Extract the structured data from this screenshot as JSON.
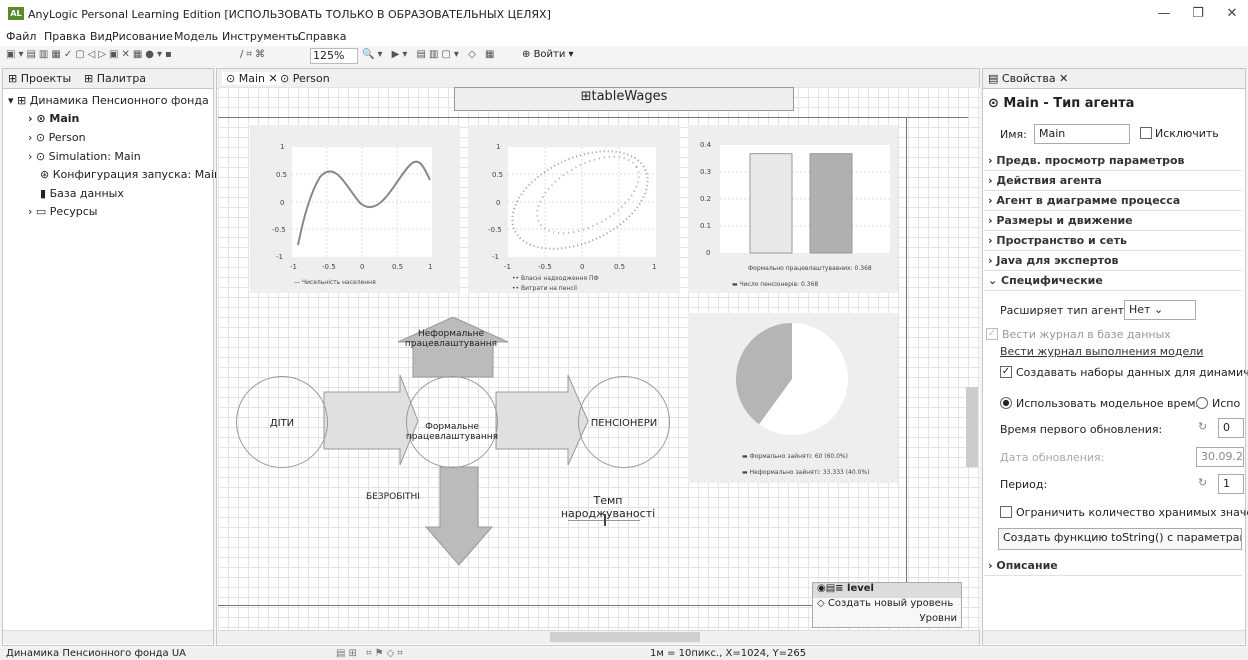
{
  "window": {
    "title": "AnyLogic Personal Learning Edition [ИСПОЛЬЗОВАТЬ ТОЛЬКО В ОБРАЗОВАТЕЛЬНЫХ ЦЕЛЯХ]",
    "app_icon_text": "AL"
  },
  "menu": [
    "Файл",
    "Правка",
    "Вид",
    "Рисование",
    "Модель",
    "Инструменты",
    "Справка"
  ],
  "toolbar": {
    "zoom": "125%",
    "login": "Войти"
  },
  "left_panel": {
    "tab_projects": "Проекты",
    "tab_palette": "Палитра",
    "tree": [
      {
        "label": "Динамика Пенсионного фонда",
        "level": 0
      },
      {
        "label": "Main",
        "level": 1,
        "bold": true
      },
      {
        "label": "Person",
        "level": 1
      },
      {
        "label": "Simulation: Main",
        "level": 1
      },
      {
        "label": "Конфигурация запуска: Main",
        "level": 1
      },
      {
        "label": "База данных",
        "level": 1
      },
      {
        "label": "Ресурсы",
        "level": 1
      }
    ]
  },
  "editor": {
    "tab_main": "Main",
    "tab_person": "Person",
    "table_label": "tableWages",
    "chart1": {
      "legend": "Чисельність населення",
      "yticks": [
        "1",
        "0.5",
        "0",
        "-0.5",
        "-1"
      ],
      "xticks": [
        "-1",
        "-0.5",
        "0",
        "0.5",
        "1"
      ]
    },
    "chart2": {
      "legend1": "Власні надходження ПФ",
      "legend2": "Витрати на пенсії",
      "yticks": [
        "1",
        "0.5",
        "0",
        "-0.5",
        "-1"
      ],
      "xticks": [
        "-1",
        "-0.5",
        "0",
        "0.5",
        "1"
      ]
    },
    "chart3": {
      "legend1": "Формально працевлаштувавних: 0.368",
      "legend2": "Число пенсіонерів: 0.368",
      "yticks": [
        "0.4",
        "0.3",
        "0.2",
        "0.1",
        "0"
      ]
    },
    "pie": {
      "legend1": "Формально зайняті: 60 (60.0%)",
      "legend2": "Неформально зайняті: 33.333 (40.0%)"
    },
    "informal": "Неформальне працевлаштування",
    "children": "ДІТИ",
    "formal": "Формальне працевлаштування",
    "pensioners": "ПЕНСІОНЕРИ",
    "unemployed": "БЕЗРОБІТНІ",
    "birthrate": "Темп народжуваності",
    "levels": {
      "level": "level",
      "create": "Создать новый уровень",
      "label": "Уровни"
    }
  },
  "chart_data": [
    {
      "type": "line",
      "title": "",
      "series": [
        {
          "name": "Чисельність населення",
          "x": [
            -0.95,
            -0.9,
            -0.8,
            -0.7,
            -0.5,
            -0.3,
            0,
            0.3,
            0.5,
            0.6,
            0.7,
            0.75
          ],
          "y": [
            -1,
            -0.5,
            0,
            0.3,
            0.55,
            0.75,
            0.85,
            1,
            1,
            0.8,
            0.4,
            0
          ]
        }
      ],
      "xlim": [
        -1,
        1
      ],
      "ylim": [
        -1,
        1
      ]
    },
    {
      "type": "scatter",
      "title": "",
      "series": [
        {
          "name": "Власні надходження ПФ"
        },
        {
          "name": "Витрати на пенсії"
        }
      ],
      "xlim": [
        -1,
        1
      ],
      "ylim": [
        -1,
        1
      ]
    },
    {
      "type": "bar",
      "title": "",
      "categories": [
        "Формально працевлаштувавних",
        "Число пенсіонерів"
      ],
      "values": [
        0.368,
        0.368
      ],
      "ylim": [
        0,
        0.4
      ]
    },
    {
      "type": "pie",
      "title": "",
      "categories": [
        "Формально зайняті",
        "Неформально зайняті"
      ],
      "values": [
        60,
        40
      ]
    }
  ],
  "properties": {
    "tab": "Свойства",
    "title": "Main - Тип агента",
    "name_label": "Имя:",
    "name_value": "Main",
    "exclude": "Исключить",
    "sections": [
      "Предв. просмотр параметров",
      "Действия агента",
      "Агент в диаграмме процесса",
      "Размеры и движение",
      "Пространство и сеть",
      "Java для экспертов",
      "Специфические"
    ],
    "extends_label": "Расширяет тип агента:",
    "extends_value": "Нет",
    "log_db": "Вести журнал в базе данных",
    "log_model": "Вести журнал выполнения модели",
    "create_datasets": "Создавать наборы данных для динамиче",
    "use_model_time": "Использовать модельное время",
    "use_other": "Испо",
    "first_update": "Время первого обновления:",
    "first_update_val": "0",
    "date_label": "Дата обновления:",
    "date_val": "30.09.2",
    "period": "Период:",
    "period_val": "1",
    "limit": "Ограничить количество хранимых значе",
    "tostring": "Создать функцию toString() с параметрами",
    "description": "Описание"
  },
  "status": {
    "left": "Динамика Пенсионного фонда UA",
    "coords": "1м = 10пикс., X=1024, Y=265"
  }
}
